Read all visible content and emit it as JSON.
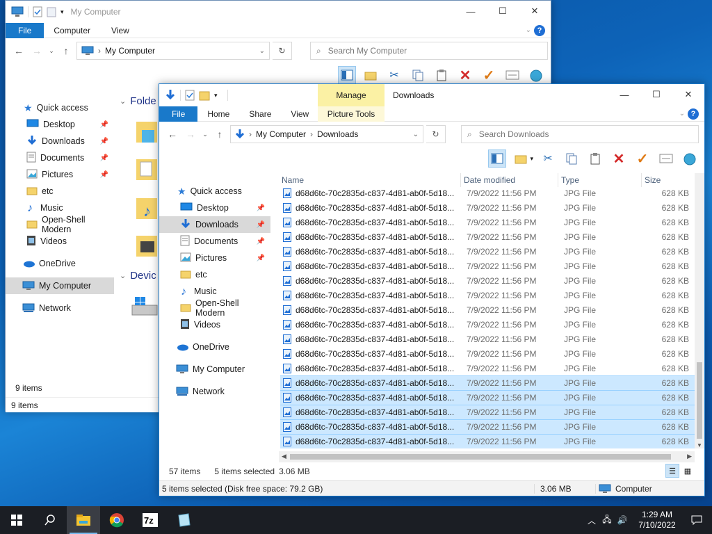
{
  "back_window": {
    "title": "My Computer",
    "tabs": [
      "File",
      "Computer",
      "View"
    ],
    "address": "My Computer",
    "search_placeholder": "Search My Computer",
    "folders_heading": "Folde",
    "devices_heading": "Devic",
    "nav": {
      "quick_access": "Quick access",
      "items": [
        {
          "label": "Desktop",
          "icon": "desktop-icon",
          "pinned": true
        },
        {
          "label": "Downloads",
          "icon": "downloads-icon",
          "pinned": true
        },
        {
          "label": "Documents",
          "icon": "documents-icon",
          "pinned": true
        },
        {
          "label": "Pictures",
          "icon": "pictures-icon",
          "pinned": true
        },
        {
          "label": "etc",
          "icon": "folder-icon",
          "pinned": false
        },
        {
          "label": "Music",
          "icon": "music-icon",
          "pinned": false
        },
        {
          "label": "Open-Shell Modern",
          "icon": "folder-icon",
          "pinned": false
        },
        {
          "label": "Videos",
          "icon": "videos-icon",
          "pinned": false
        }
      ],
      "onedrive": "OneDrive",
      "my_computer": "My Computer",
      "network": "Network"
    },
    "status_inner": "9 items",
    "status_outer": "9 items"
  },
  "front_window": {
    "title": "Downloads",
    "context_tab": "Manage",
    "context_subtab": "Picture Tools",
    "tabs": [
      "File",
      "Home",
      "Share",
      "View"
    ],
    "breadcrumb": [
      "My Computer",
      "Downloads"
    ],
    "search_placeholder": "Search Downloads",
    "nav": {
      "quick_access": "Quick access",
      "items": [
        {
          "label": "Desktop",
          "icon": "desktop-icon",
          "pinned": true
        },
        {
          "label": "Downloads",
          "icon": "downloads-icon",
          "pinned": true
        },
        {
          "label": "Documents",
          "icon": "documents-icon",
          "pinned": true
        },
        {
          "label": "Pictures",
          "icon": "pictures-icon",
          "pinned": true
        },
        {
          "label": "etc",
          "icon": "folder-icon",
          "pinned": false
        },
        {
          "label": "Music",
          "icon": "music-icon",
          "pinned": false
        },
        {
          "label": "Open-Shell Modern",
          "icon": "folder-icon",
          "pinned": false
        },
        {
          "label": "Videos",
          "icon": "videos-icon",
          "pinned": false
        }
      ],
      "onedrive": "OneDrive",
      "my_computer": "My Computer",
      "network": "Network"
    },
    "columns": {
      "name": "Name",
      "date": "Date modified",
      "type": "Type",
      "size": "Size"
    },
    "file_name": "d68d6tc-70c2835d-c837-4d81-ab0f-5d18...",
    "file_date": "7/9/2022 11:56 PM",
    "file_type": "JPG File",
    "file_size": "628 KB",
    "row_count": 18,
    "selected_rows": [
      13,
      14,
      15,
      16,
      17
    ],
    "status_items": "57 items",
    "status_selected": "5 items selected",
    "status_size": "3.06 MB",
    "bottom_status": "5 items selected (Disk free space: 79.2 GB)",
    "bottom_size": "3.06 MB",
    "bottom_location": "Computer"
  },
  "taskbar": {
    "time": "1:29 AM",
    "date": "7/10/2022"
  }
}
